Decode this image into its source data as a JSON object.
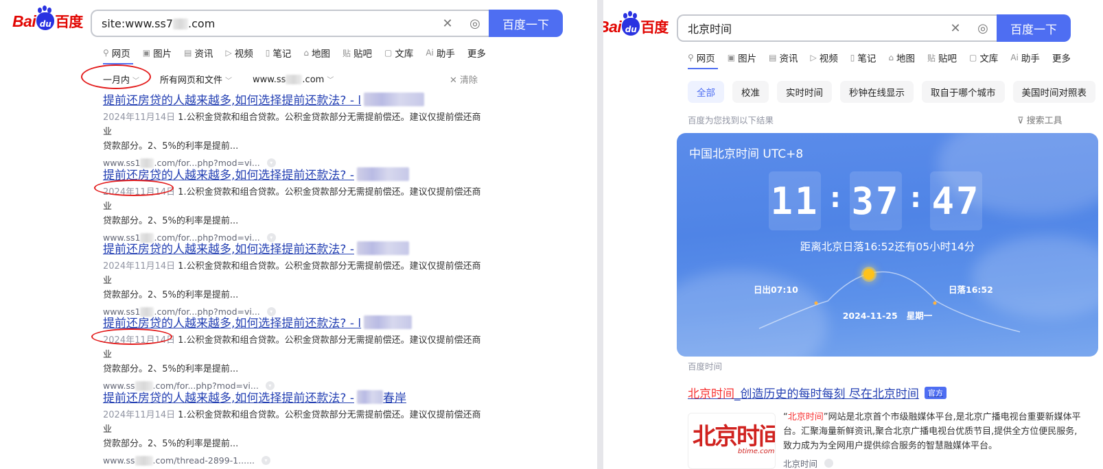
{
  "left": {
    "logo": {
      "latin": "Bai",
      "paw": "du",
      "chinese": "百度"
    },
    "search": {
      "query": "site:www.ss7",
      "query_suffix": ".com",
      "button": "百度一下"
    },
    "tabs": [
      {
        "icon": "search-icon",
        "label": "网页",
        "active": true
      },
      {
        "icon": "image-icon",
        "label": "图片"
      },
      {
        "icon": "news-icon",
        "label": "资讯"
      },
      {
        "icon": "video-icon",
        "label": "视频"
      },
      {
        "icon": "note-icon",
        "label": "笔记"
      },
      {
        "icon": "map-icon",
        "label": "地图"
      },
      {
        "icon": "tieba-icon",
        "label": "贴吧"
      },
      {
        "icon": "doc-icon",
        "label": "文库"
      },
      {
        "icon": "ai-icon",
        "label": "助手"
      },
      {
        "label": "更多"
      }
    ],
    "filters": {
      "time": "一月内",
      "type": "所有网页和文件",
      "site_prefix": "www.ss",
      "site_suffix": ".com",
      "clear": "清除"
    },
    "results": [
      {
        "title": "提前还房贷的人越来越多,如何选择提前还款法? - l",
        "date": "2024年11月14日",
        "abstract_line1": "1.公积金贷款和组合贷款。公积金贷款部分无需提前偿还。建议仅提前偿还商业",
        "abstract_line2": "贷款部分。2、5%的利率是提前...",
        "url_prefix": "www.ss1",
        "url_suffix": ".com/for...php?mod=vi..."
      },
      {
        "title": "提前还房贷的人越来越多,如何选择提前还款法? -",
        "date": "2024年11月14日",
        "abstract_line1": "1.公积金贷款和组合贷款。公积金贷款部分无需提前偿还。建议仅提前偿还商业",
        "abstract_line2": "贷款部分。2、5%的利率是提前...",
        "url_prefix": "www.ss1",
        "url_suffix": ".com/for...php?mod=vi..."
      },
      {
        "title": "提前还房贷的人越来越多,如何选择提前还款法? -",
        "date": "2024年11月14日",
        "abstract_line1": "1.公积金贷款和组合贷款。公积金贷款部分无需提前偿还。建议仅提前偿还商业",
        "abstract_line2": "贷款部分。2、5%的利率是提前...",
        "url_prefix": "www.ss1",
        "url_suffix": ".com/for...php?mod=vi..."
      },
      {
        "title": "提前还房贷的人越来越多,如何选择提前还款法? - l",
        "date": "2024年11月14日",
        "abstract_line1": "1.公积金贷款和组合贷款。公积金贷款部分无需提前偿还。建议仅提前偿还商业",
        "abstract_line2": "贷款部分。2、5%的利率是提前...",
        "url_prefix": "www.ss",
        "url_suffix": ".com/for...php?mod=vi..."
      },
      {
        "title": "提前还房贷的人越来越多,如何选择提前还款法? -",
        "title_tail": "春岸",
        "date": "2024年11月14日",
        "abstract_line1": "1.公积金贷款和组合贷款。公积金贷款部分无需提前偿还。建议仅提前偿还商业",
        "abstract_line2": "贷款部分。2、5%的利率是提前...",
        "url_prefix": "www.ss",
        "url_suffix": ".com/thread-2899-1......"
      }
    ]
  },
  "right": {
    "logo": {
      "latin": "Bai",
      "paw": "du",
      "chinese": "百度"
    },
    "search": {
      "query": "北京时间",
      "button": "百度一下"
    },
    "tabs": [
      {
        "icon": "search-icon",
        "label": "网页",
        "active": true
      },
      {
        "icon": "image-icon",
        "label": "图片"
      },
      {
        "icon": "news-icon",
        "label": "资讯"
      },
      {
        "icon": "video-icon",
        "label": "视频"
      },
      {
        "icon": "note-icon",
        "label": "笔记"
      },
      {
        "icon": "map-icon",
        "label": "地图"
      },
      {
        "icon": "tieba-icon",
        "label": "贴吧"
      },
      {
        "icon": "doc-icon",
        "label": "文库"
      },
      {
        "icon": "ai-icon",
        "label": "助手"
      },
      {
        "label": "更多"
      }
    ],
    "chips": [
      "全部",
      "校准",
      "实时时间",
      "秒钟在线显示",
      "取自于哪个城市",
      "美国时间对照表"
    ],
    "found_text": "百度为您找到以下结果",
    "tools_label": "搜索工具",
    "clock": {
      "title": "中国北京时间 UTC+8",
      "hours": "11",
      "minutes": "37",
      "seconds": "47",
      "sunset_note": "距离北京日落16:52还有05小时14分",
      "sunrise": "日出07:10",
      "sunset": "日落16:52",
      "date": "2024-11-25",
      "weekday": "星期一"
    },
    "source": "百度时间",
    "result": {
      "title_hl": "北京时间",
      "title_rest": "_创造历史的每时每刻 尽在北京时间",
      "badge": "官方",
      "abstract_quote_open": "“",
      "abstract_hl": "北京时间",
      "abstract_rest": "”网站是北京首个市级融媒体平台,是北京广播电视台重要新媒体平台。汇聚海量新鲜资讯,聚合北京广播电视台优质节目,提供全方位便民服务,致力成为为全网用户提供综合服务的智慧融媒体平台。",
      "site": "北京时间",
      "logo_cn": "北京时间",
      "logo_en": "btime.com"
    }
  },
  "colors": {
    "brand_blue": "#4e6ef2",
    "link_blue": "#2440b3",
    "highlight_red": "#f73131",
    "annotation_red": "#e31b1b"
  }
}
